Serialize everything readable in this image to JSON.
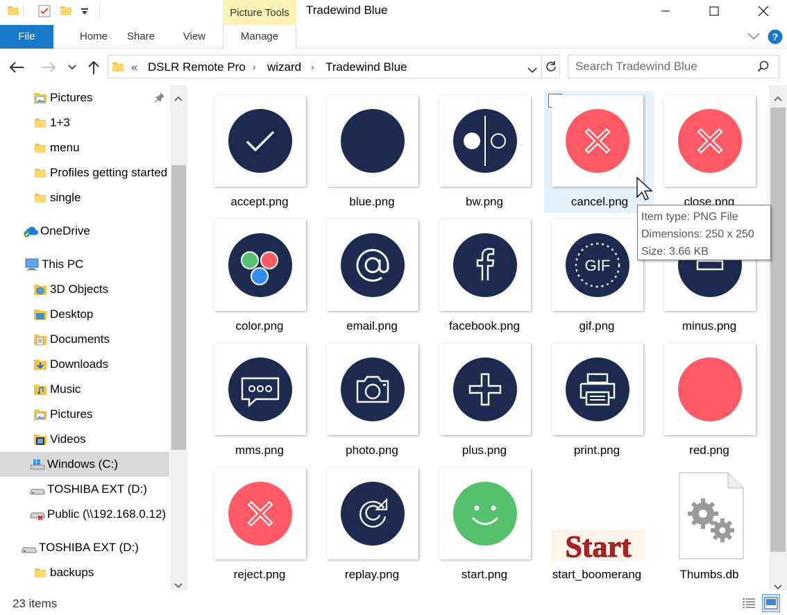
{
  "window": {
    "title": "Tradewind Blue",
    "context_tab_group": "Picture Tools"
  },
  "ribbon": {
    "tabs": [
      {
        "label": "File"
      },
      {
        "label": "Home"
      },
      {
        "label": "Share"
      },
      {
        "label": "View"
      },
      {
        "label": "Manage"
      }
    ]
  },
  "address": {
    "overflow": "«",
    "crumbs": [
      "DSLR Remote Pro",
      "wizard",
      "Tradewind Blue"
    ],
    "search_placeholder": "Search Tradewind Blue"
  },
  "nav": {
    "items": [
      {
        "label": "Pictures",
        "icon": "folder-pictures-icon",
        "pinned": true
      },
      {
        "label": "1+3",
        "icon": "folder-icon"
      },
      {
        "label": "menu",
        "icon": "folder-icon"
      },
      {
        "label": "Profiles getting started",
        "icon": "folder-icon"
      },
      {
        "label": "single",
        "icon": "folder-icon"
      },
      {
        "label": "OneDrive",
        "icon": "onedrive-icon"
      },
      {
        "label": "This PC",
        "icon": "this-pc-icon"
      },
      {
        "label": "3D Objects",
        "icon": "3d-objects-icon"
      },
      {
        "label": "Desktop",
        "icon": "desktop-folder-icon"
      },
      {
        "label": "Documents",
        "icon": "documents-icon"
      },
      {
        "label": "Downloads",
        "icon": "downloads-icon"
      },
      {
        "label": "Music",
        "icon": "music-icon"
      },
      {
        "label": "Pictures",
        "icon": "folder-pictures-icon"
      },
      {
        "label": "Videos",
        "icon": "videos-icon"
      },
      {
        "label": "Windows (C:)",
        "icon": "windows-drive-icon",
        "selected": true
      },
      {
        "label": "TOSHIBA EXT (D:)",
        "icon": "drive-icon"
      },
      {
        "label": "Public (\\\\192.168.0.12)",
        "icon": "network-drive-disconnected-icon"
      },
      {
        "label": "TOSHIBA EXT (D:)",
        "icon": "drive-icon"
      },
      {
        "label": "backups",
        "icon": "folder-icon"
      }
    ]
  },
  "files": [
    {
      "name": "accept.png",
      "icon": "check-icon"
    },
    {
      "name": "blue.png",
      "icon": "solid-circle-icon"
    },
    {
      "name": "bw.png",
      "icon": "bw-toggle-icon"
    },
    {
      "name": "cancel.png",
      "icon": "cancel-x-icon",
      "selected": true
    },
    {
      "name": "close.png",
      "icon": "close-x-icon"
    },
    {
      "name": "color.png",
      "icon": "color-dots-icon"
    },
    {
      "name": "email.png",
      "icon": "at-sign-icon"
    },
    {
      "name": "facebook.png",
      "icon": "facebook-icon"
    },
    {
      "name": "gif.png",
      "icon": "gif-icon",
      "badge_text": "GIF"
    },
    {
      "name": "minus.png",
      "icon": "minus-icon"
    },
    {
      "name": "mms.png",
      "icon": "message-icon"
    },
    {
      "name": "photo.png",
      "icon": "camera-icon"
    },
    {
      "name": "plus.png",
      "icon": "plus-icon"
    },
    {
      "name": "print.png",
      "icon": "printer-icon"
    },
    {
      "name": "red.png",
      "icon": "red-circle-icon"
    },
    {
      "name": "reject.png",
      "icon": "reject-x-icon"
    },
    {
      "name": "replay.png",
      "icon": "replay-icon"
    },
    {
      "name": "start.png",
      "icon": "smiley-icon"
    },
    {
      "name": "start_boomerang",
      "icon": "start-text-image-icon",
      "image_text": "Start"
    },
    {
      "name": "Thumbs.db",
      "icon": "settings-file-icon"
    }
  ],
  "tooltip": {
    "lines": [
      "Item type: PNG File",
      "Dimensions: 250 x 250",
      "Size: 3.66 KB"
    ]
  },
  "status": {
    "item_count": "23 items"
  },
  "colors": {
    "navy": "#1c2b4f",
    "red": "#fe5a66",
    "green": "#55c16f",
    "blue_dot": "#2e8ff0",
    "file_tab": "#1979ca",
    "picture_tools": "#fbf3b5",
    "selection": "#e5f1fb"
  }
}
